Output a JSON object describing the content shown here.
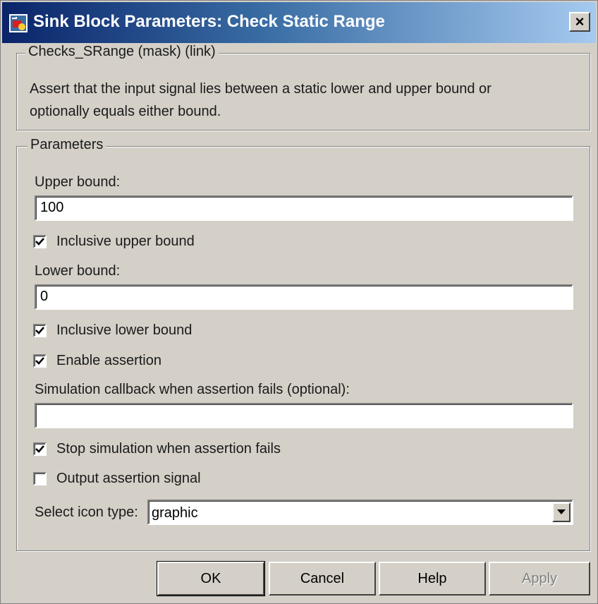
{
  "window": {
    "title": "Sink Block Parameters: Check  Static Range",
    "close_label": "×"
  },
  "mask": {
    "legend": "Checks_SRange (mask) (link)",
    "description": "Assert that the input signal lies between a static lower and upper bound or optionally equals either bound."
  },
  "params": {
    "legend": "Parameters",
    "upper_bound_label": "Upper bound:",
    "upper_bound_value": "100",
    "inclusive_upper_label": "Inclusive upper bound",
    "inclusive_upper_checked": true,
    "lower_bound_label": "Lower bound:",
    "lower_bound_value": "0",
    "inclusive_lower_label": "Inclusive lower bound",
    "inclusive_lower_checked": true,
    "enable_assertion_label": "Enable assertion",
    "enable_assertion_checked": true,
    "callback_label": "Simulation callback when assertion fails (optional):",
    "callback_value": "",
    "stop_sim_label": "Stop simulation when assertion fails",
    "stop_sim_checked": true,
    "output_signal_label": "Output assertion signal",
    "output_signal_checked": false,
    "icon_type_label": "Select icon type:",
    "icon_type_value": "graphic"
  },
  "buttons": {
    "ok": "OK",
    "cancel": "Cancel",
    "help": "Help",
    "apply": "Apply"
  },
  "icons": {
    "title_icon": "simulink-block-icon",
    "check": "checkmark-icon",
    "dropdown": "chevron-down-icon"
  }
}
